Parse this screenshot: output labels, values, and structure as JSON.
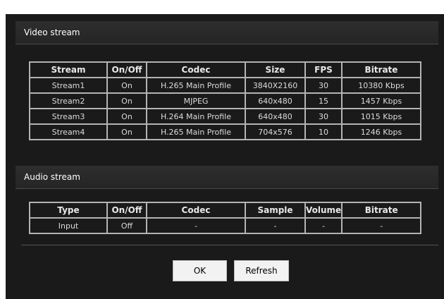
{
  "video_stream": {
    "title": "Video stream",
    "columns": [
      "Stream",
      "On/Off",
      "Codec",
      "Size",
      "FPS",
      "Bitrate"
    ],
    "rows": [
      [
        "Stream1",
        "On",
        "H.265 Main Profile",
        "3840X2160",
        "30",
        "10380 Kbps"
      ],
      [
        "Stream2",
        "On",
        "MJPEG",
        "640x480",
        "15",
        "1457 Kbps"
      ],
      [
        "Stream3",
        "On",
        "H.264 Main Profile",
        "640x480",
        "30",
        "1015 Kbps"
      ],
      [
        "Stream4",
        "On",
        "H.265 Main Profile",
        "704x576",
        "10",
        "1246 Kbps"
      ]
    ]
  },
  "audio_stream": {
    "title": "Audio stream",
    "columns": [
      "Type",
      "On/Off",
      "Codec",
      "Sample",
      "Volume",
      "Bitrate"
    ],
    "rows": [
      [
        "Input",
        "Off",
        "-",
        "-",
        "-",
        "-"
      ]
    ]
  },
  "buttons": {
    "ok_label": "OK",
    "refresh_label": "Refresh"
  }
}
